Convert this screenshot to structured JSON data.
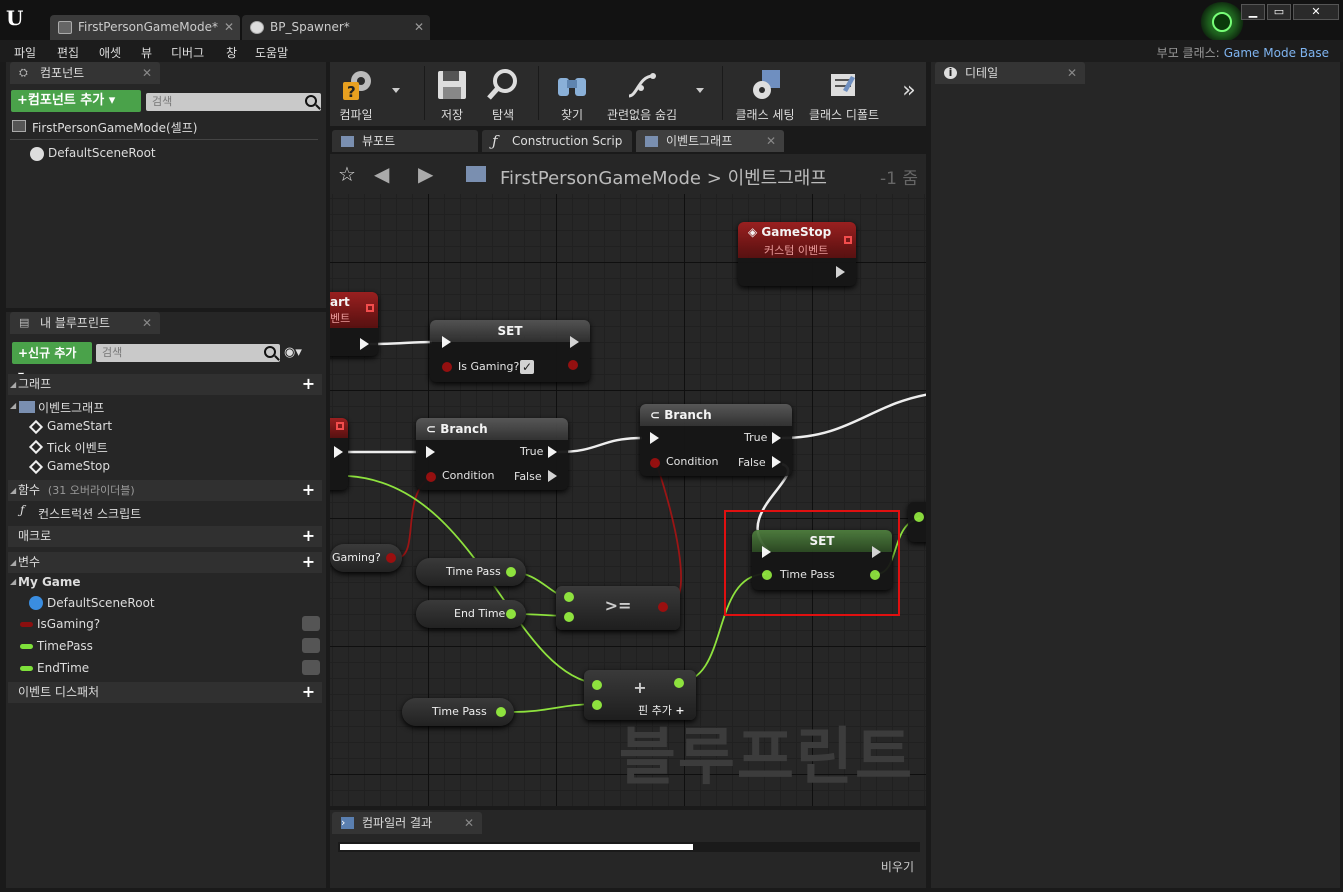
{
  "tabs": [
    {
      "label": "FirstPersonGameMode*",
      "close": "✕"
    },
    {
      "label": "BP_Spawner*",
      "close": "✕"
    }
  ],
  "window": {
    "minimize": "▁",
    "maximize": "▭",
    "close": "✕"
  },
  "menu": [
    "파일",
    "편집",
    "애셋",
    "뷰",
    "디버그",
    "창",
    "도움말"
  ],
  "parent_class": {
    "label": "부모 클래스:",
    "value": "Game Mode Base"
  },
  "components": {
    "tab": "컴포넌트",
    "add_button": "+컴포넌트 추가",
    "search_placeholder": "검색",
    "root": "FirstPersonGameMode(셀프)",
    "child": "DefaultSceneRoot"
  },
  "my_blueprint": {
    "tab": "내 블루프린트",
    "add_button": "+신규 추가",
    "search_placeholder": "검색",
    "sections": {
      "graphs": "그래프",
      "event_graph": "이벤트그래프",
      "events": [
        "GameStart",
        "Tick 이벤트",
        "GameStop"
      ],
      "functions": "함수",
      "functions_overridable": "(31 오버라이더블)",
      "construction": "컨스트럭션 스크립트",
      "macros": "매크로",
      "variables": "변수",
      "category": "My Game",
      "var_items": [
        {
          "label": "DefaultSceneRoot"
        },
        {
          "label": "IsGaming?",
          "color": "#8b0f0f"
        },
        {
          "label": "TimePass",
          "color": "#7ee03a"
        },
        {
          "label": "EndTime",
          "color": "#7ee03a"
        }
      ],
      "dispatchers": "이벤트 디스패처"
    }
  },
  "toolbar": {
    "compile": "컴파일",
    "save": "저장",
    "browse": "탐색",
    "find": "찾기",
    "hide_unrelated": "관련없음 숨김",
    "class_settings": "클래스 세팅",
    "class_defaults": "클래스 디폴트",
    "more": "»"
  },
  "graph_tabs": [
    "뷰포트",
    "Construction Scrip",
    "이벤트그래프"
  ],
  "breadcrumb": {
    "blueprint": "FirstPersonGameMode",
    "sep": ">",
    "graph": "이벤트그래프",
    "zoom": "-1 줌"
  },
  "graph": {
    "watermark": "블루프린트",
    "nodes": {
      "gamestop_title": "GameStop",
      "gamestop_sub": "커스텀 이벤트",
      "gamestart_title": "art",
      "gamestart_sub": "벤트",
      "set1_title": "SET",
      "set1_pin": "Is Gaming?",
      "branch1_title": "Branch",
      "branch2_title": "Branch",
      "true_label": "True",
      "false_label": "False",
      "condition_label": "Condition",
      "set2_title": "SET",
      "set2_pin": "Time Pass",
      "var_time_pass": "Time Pass",
      "var_end_time": "End Time",
      "var_is_gaming": "Gaming?",
      "op_ge": ">=",
      "op_add": "+",
      "add_pin": "핀 추가",
      "add_pin_plus": "+"
    }
  },
  "compiler": {
    "tab": "컴파일러 결과",
    "clear": "비우기",
    "progress": 0.61
  },
  "details": {
    "tab": "디테일"
  }
}
